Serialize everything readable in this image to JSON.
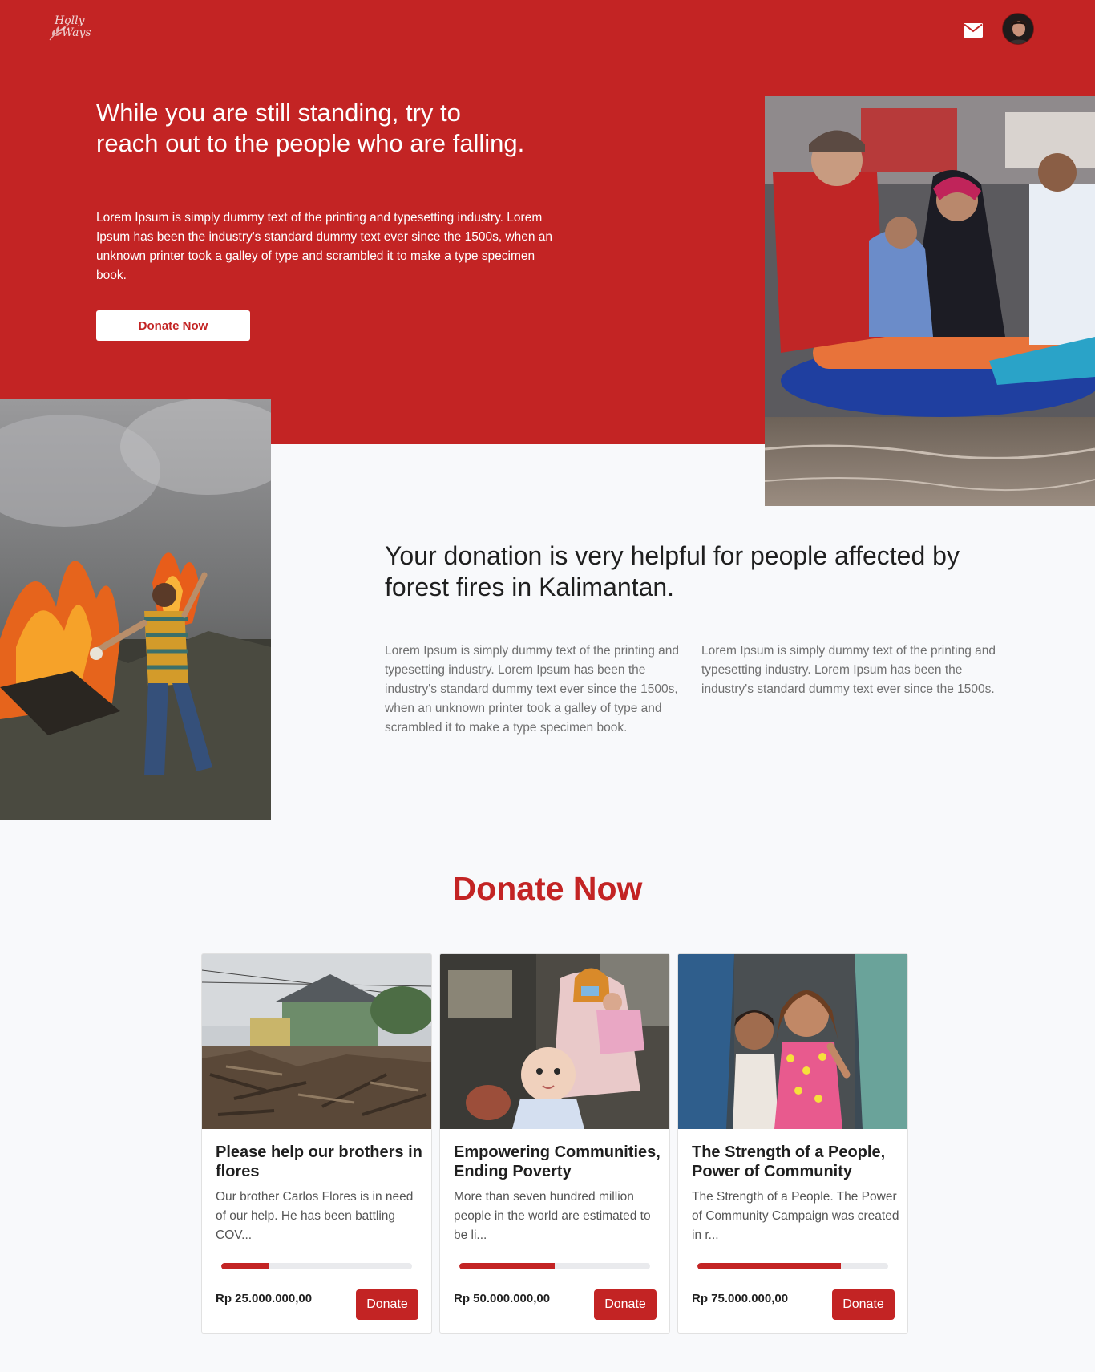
{
  "nav": {
    "logo_line1": "Holly",
    "logo_line2": "Ways"
  },
  "hero": {
    "title": "While you are still standing, try to reach out to the people who are falling.",
    "text": "Lorem Ipsum is simply dummy text of the printing and typesetting industry. Lorem Ipsum has been the industry's standard dummy text ever since the 1500s, when an unknown printer took a galley of type and scrambled it to make a type specimen book.",
    "button_label": "Donate Now"
  },
  "about": {
    "title": "Your donation is very helpful for people affected by forest fires in Kalimantan.",
    "paragraph_1": "Lorem Ipsum is simply dummy text of the printing and typesetting industry. Lorem Ipsum has been the industry's standard dummy text ever since the 1500s, when an unknown printer took a galley of type and scrambled it to make a type specimen book.",
    "paragraph_2": "Lorem Ipsum is simply dummy text of the printing and typesetting industry. Lorem Ipsum has been the industry's standard dummy text ever since the 1500s."
  },
  "donate": {
    "heading": "Donate Now",
    "cards": [
      {
        "title": "Please help our brothers in flores",
        "description": "Our brother Carlos Flores is in need of our help. He has been battling COV...",
        "progress": 0.25,
        "amount": "Rp 25.000.000,00",
        "button_label": "Donate"
      },
      {
        "title": "Empowering Communities, Ending Poverty",
        "description": "More than seven hundred million people in the world are estimated to be li...",
        "progress": 0.5,
        "amount": "Rp 50.000.000,00",
        "button_label": "Donate"
      },
      {
        "title": "The Strength of a People, Power of Community",
        "description": "The Strength of a People. The Power of Community Campaign was created in r...",
        "progress": 0.75,
        "amount": "Rp 75.000.000,00",
        "button_label": "Donate"
      }
    ]
  },
  "colors": {
    "brand": "#c32424",
    "background": "#f8f9fb",
    "progress_track": "#e9eaed"
  }
}
